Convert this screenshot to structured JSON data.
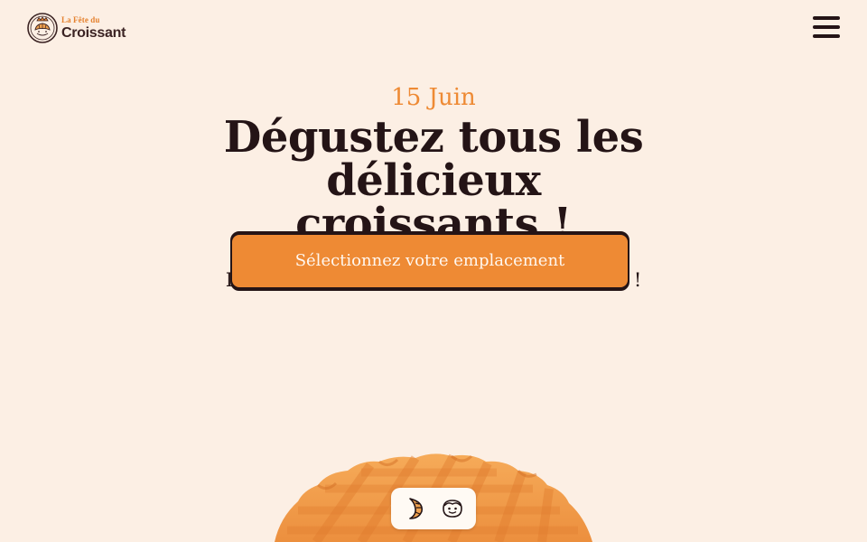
{
  "header": {
    "logo_small": "La Fête du",
    "logo_big": "Croissant",
    "emblem_icon": "crowned-croissant-emblem-icon",
    "menu_icon": "hamburger-menu-icon"
  },
  "hero": {
    "date": "15 Juin",
    "title": "Dégustez tous les délicieux croissants !",
    "subtitle": "Découvrez les meilleurs croissants locaux !",
    "cta_label": "Sélectionnez votre emplacement"
  },
  "view_toggle": {
    "options": [
      "croissant-icon",
      "smiling-face-icon"
    ]
  },
  "colors": {
    "background": "#fcefe4",
    "accent": "#ee8a34",
    "text": "#241416",
    "pastry": "#f0a24f"
  }
}
